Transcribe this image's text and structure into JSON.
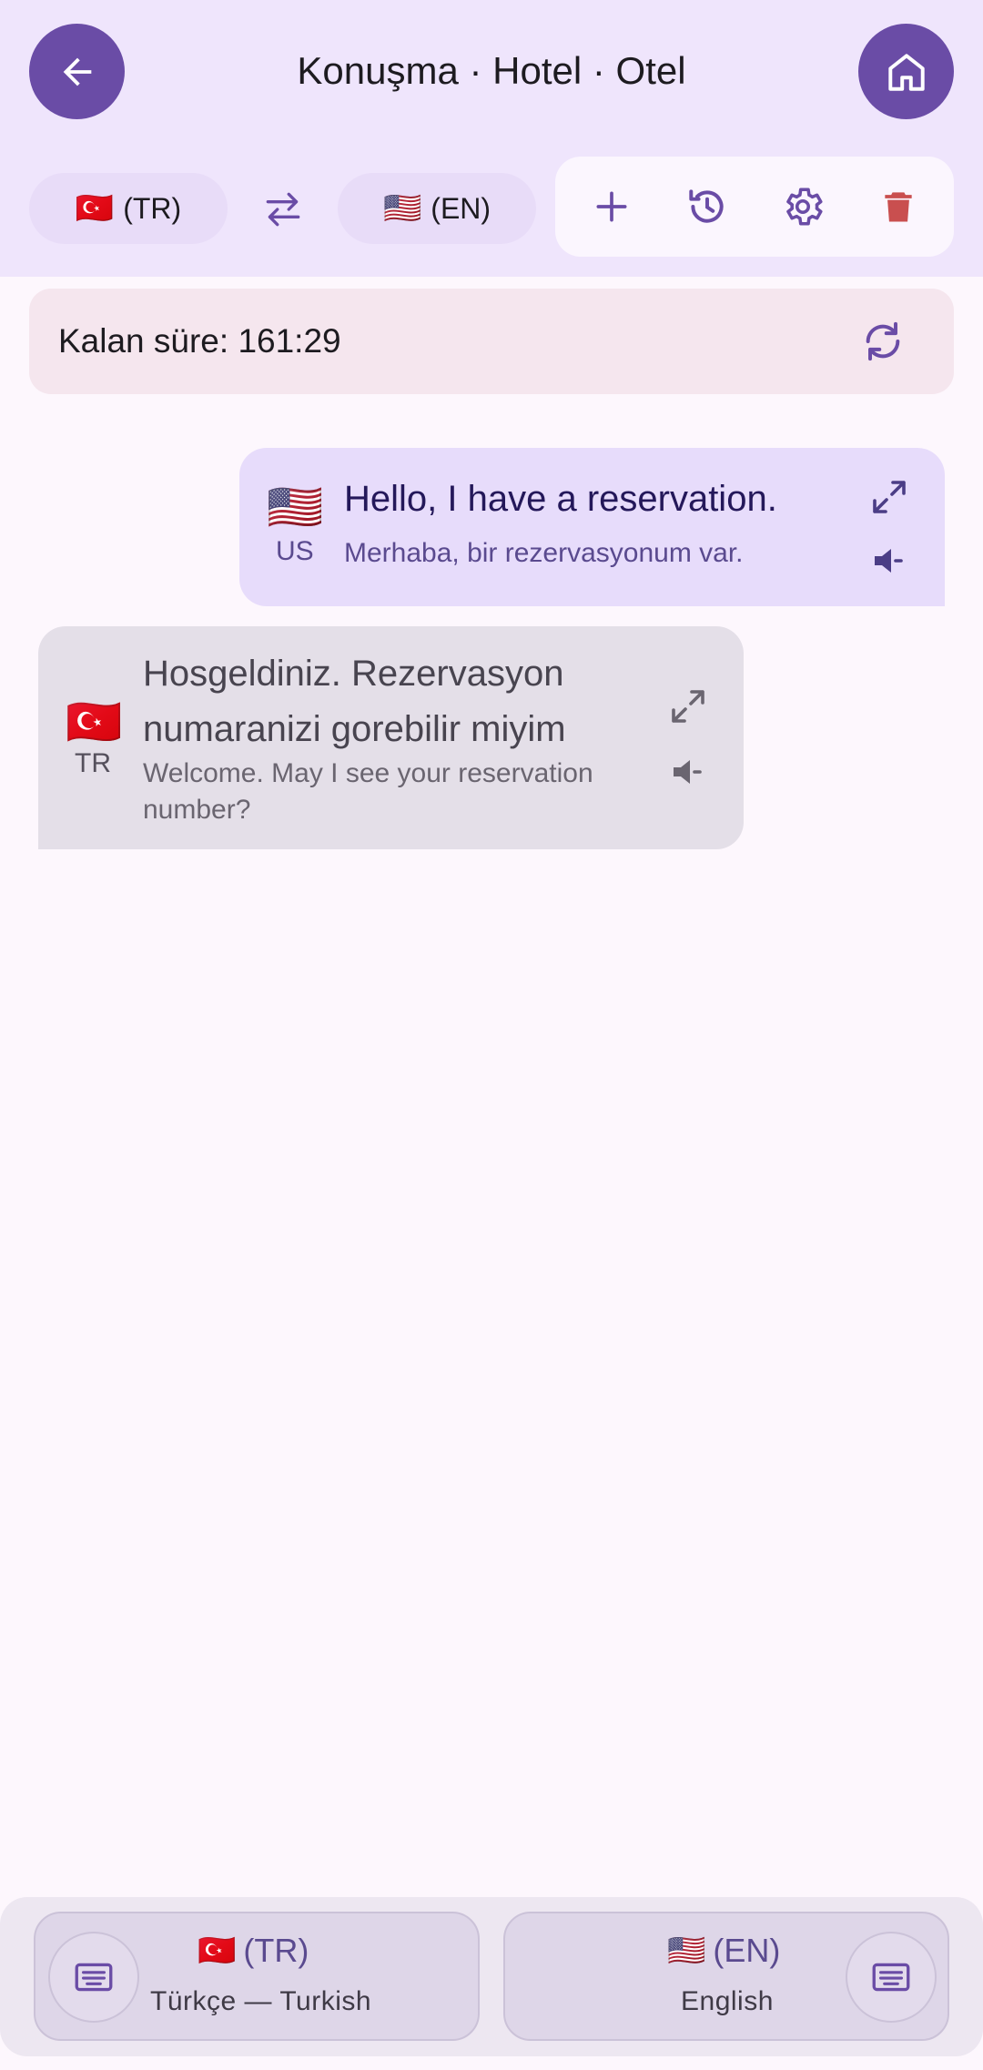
{
  "header": {
    "title": "Konuşma · Hotel · Otel",
    "source_lang": {
      "flag": "🇹🇷",
      "code": "(TR)"
    },
    "target_lang": {
      "flag": "🇺🇸",
      "code": "(EN)"
    },
    "icons": {
      "back": "arrow-left-icon",
      "home": "home-icon",
      "swap": "swap-icon",
      "add": "plus-icon",
      "history": "history-icon",
      "settings": "gear-icon",
      "delete": "trash-icon"
    }
  },
  "timer": {
    "text": "Kalan süre: 161:29",
    "icon": "refresh-icon"
  },
  "messages": [
    {
      "flag": "🇺🇸",
      "code": "US",
      "text": "Hello, I have a reservation.",
      "translation": "Merhaba, bir rezervasyonum var."
    },
    {
      "flag": "🇹🇷",
      "code": "TR",
      "text_line1": "Hosgeldiniz. Rezervasyon",
      "text_line2": "numaranizi gorebilir miyim",
      "translation_line1": "Welcome. May I see your reservation",
      "translation_line2": "number?"
    }
  ],
  "bottom": {
    "left": {
      "flag": "🇹🇷",
      "code": "(TR)",
      "name": "Türkçe — Turkish"
    },
    "right": {
      "flag": "🇺🇸",
      "code": "(EN)",
      "name": "English"
    }
  },
  "colors": {
    "accent": "#6a4ca6",
    "header_bg": "#efe5fc",
    "delete": "#c94f4f",
    "bubble_us": "#e7dcfb",
    "bubble_tr": "#e4dfe8"
  }
}
